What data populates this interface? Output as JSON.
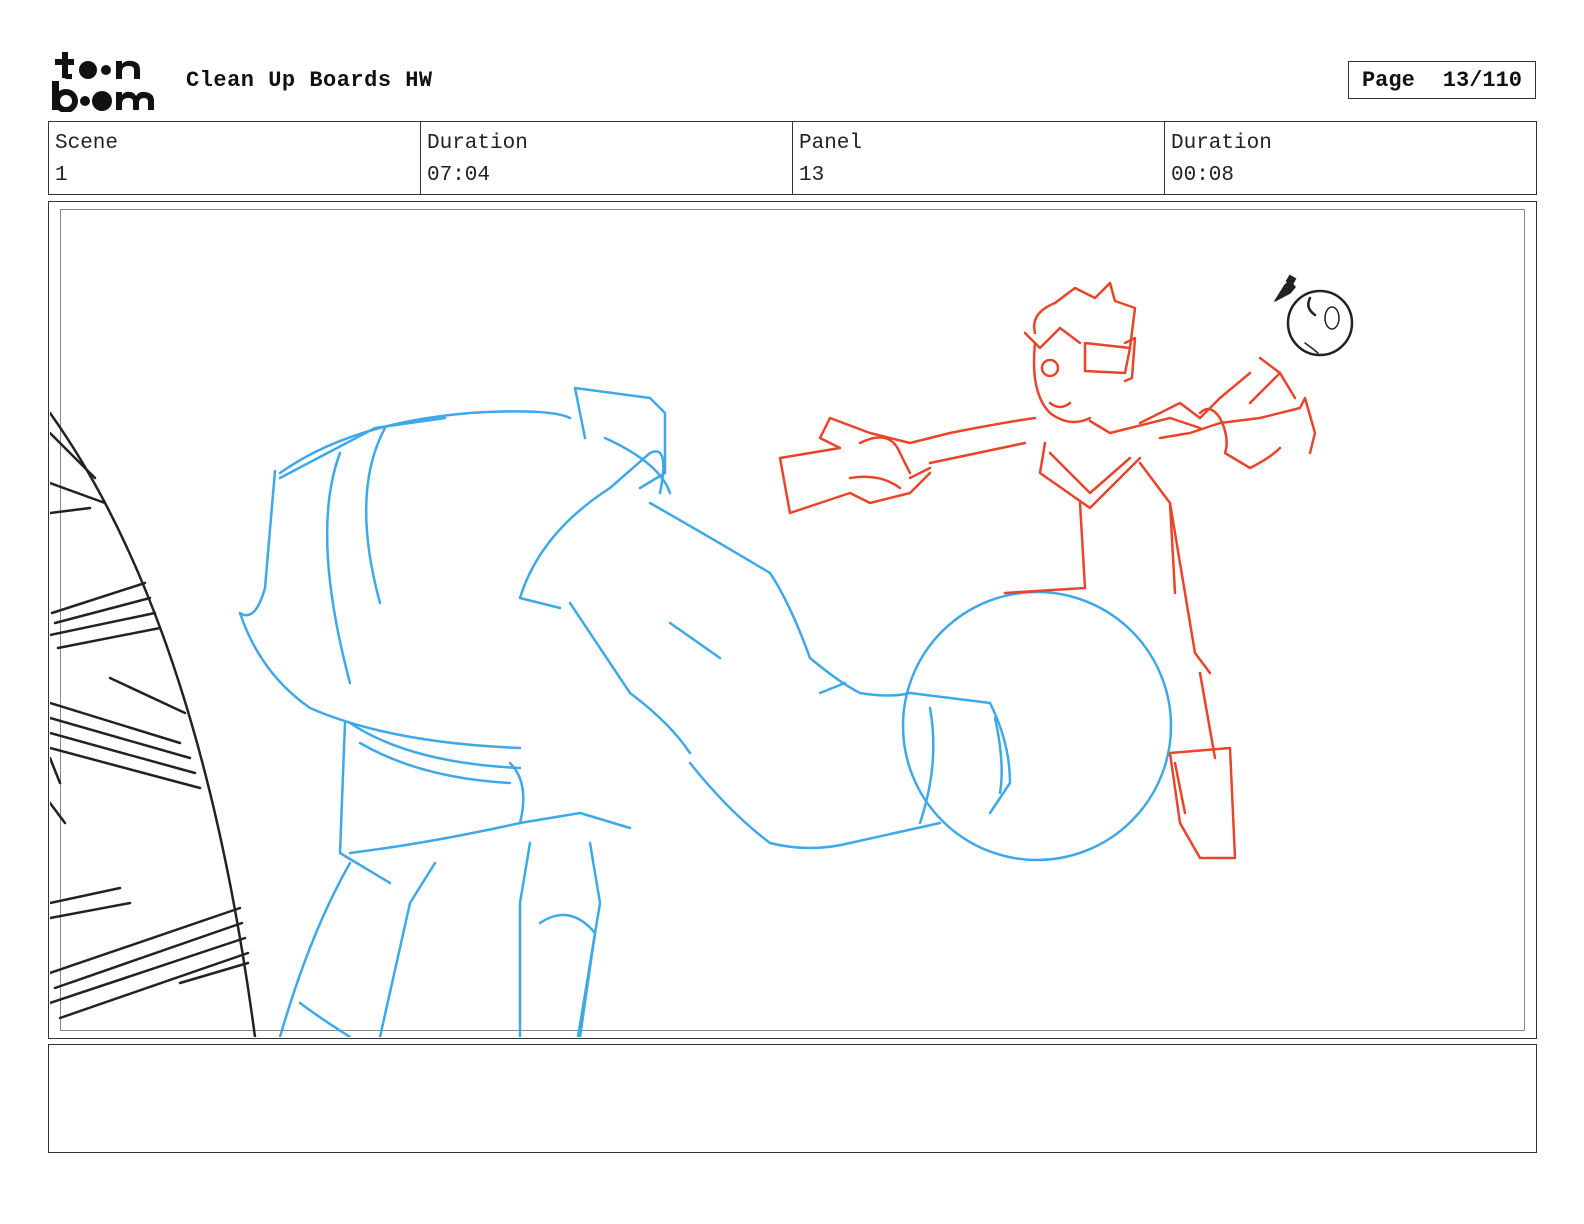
{
  "header": {
    "logo_text": "toonboom",
    "title": "Clean Up Boards HW",
    "page_label": "Page",
    "page_value": "13/110"
  },
  "info": {
    "scene_label": "Scene",
    "scene_value": "1",
    "duration_label": "Duration",
    "duration_value": "07:04",
    "panel_label": "Panel",
    "panel_value": "13",
    "panel_duration_label": "Duration",
    "panel_duration_value": "00:08"
  },
  "panel": {
    "sketch_colors": {
      "blue": "#3fa8e6",
      "red": "#e8452a",
      "black": "#222222"
    }
  },
  "notes": {
    "text": ""
  }
}
